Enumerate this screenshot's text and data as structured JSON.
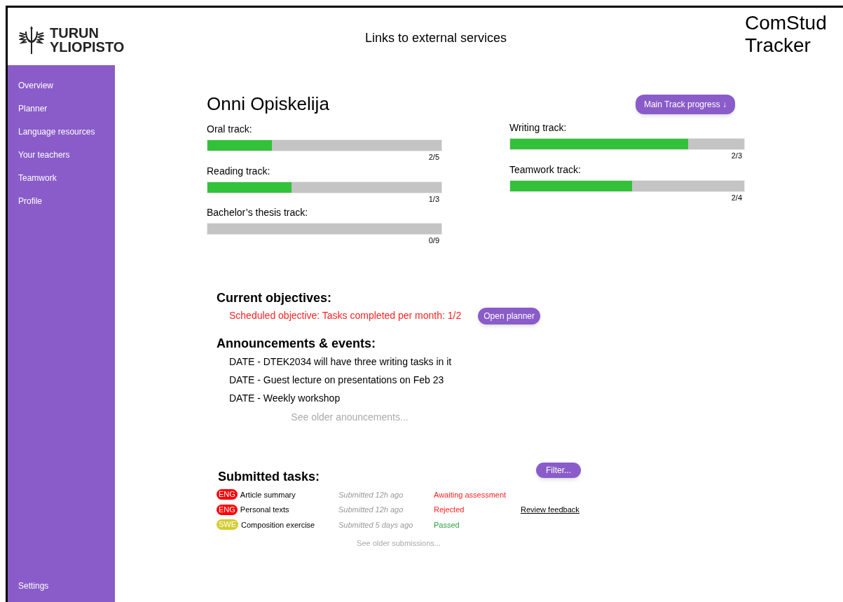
{
  "header": {
    "logo_line_1": "TURUN",
    "logo_line_2": "YLIOPISTO",
    "links": "Links to external services",
    "app_title": "ComStud Tracker"
  },
  "sidebar": {
    "items": [
      {
        "label": "Overview"
      },
      {
        "label": "Planner"
      },
      {
        "label": "Language resources"
      },
      {
        "label": "Your teachers"
      },
      {
        "label": "Teamwork"
      },
      {
        "label": "Profile"
      }
    ],
    "bottom_item": "Settings"
  },
  "student": {
    "name": "Onni Opiskelija",
    "main_button": "Main Track progress ↓"
  },
  "tracks_left": [
    {
      "label": "Oral track:",
      "level": 0.275,
      "reading": "2/5"
    },
    {
      "label": "Reading track:",
      "level": 0.36,
      "reading": "1/3"
    },
    {
      "label": "Bachelor’s thesis track:",
      "level": 0,
      "reading": "0/9"
    }
  ],
  "tracks_right": [
    {
      "label": "Writing track:",
      "level": 0.76,
      "reading": "2/3"
    },
    {
      "label": "Teamwork track:",
      "level": 0.52,
      "reading": "2/4"
    }
  ],
  "objectives": {
    "title": "Current objectives:",
    "items": [
      "Scheduled objective: Tasks completed per month: 1/2"
    ],
    "button": "Open planner"
  },
  "announcements": {
    "title": "Announcements & events:",
    "items": [
      "DATE - DTEK2034 will have three writing tasks in it",
      "DATE - Guest lecture on presentations on Feb 23",
      "DATE - Weekly workshop"
    ],
    "more": "See older anouncements..."
  },
  "submitted": {
    "title": "Submitted tasks:",
    "filter": "Filter...",
    "rows": [
      {
        "tag": {
          "label": "ENG",
          "color": "#ff0000"
        },
        "task": "Article summary",
        "submitted": "Submitted 12h ago",
        "status": {
          "text": "Awaiting assessment",
          "color": "#ff2020"
        }
      },
      {
        "tag": {
          "label": "ENG",
          "color": "#ff0000"
        },
        "task": "Personal texts",
        "submitted": "Submitted 12h ago",
        "status": {
          "text": "Rejected",
          "color": "#ff2020"
        },
        "action": "Review feedback"
      },
      {
        "tag": {
          "label": "SWE",
          "color": "#d4cc30"
        },
        "task": "Composition exercise",
        "submitted": "Submitted 5 days ago",
        "status": {
          "text": "Passed",
          "color": "#2a9d3a"
        }
      }
    ],
    "more": "See older submissions..."
  }
}
